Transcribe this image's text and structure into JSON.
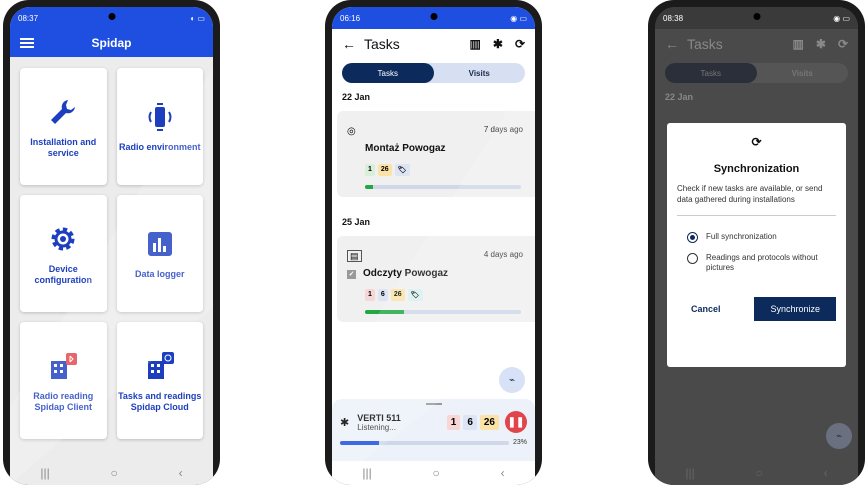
{
  "phone1": {
    "status_time": "08:37",
    "app_title": "Spidap",
    "tiles": [
      {
        "label": "Installation and service",
        "icon": "wrench-icon"
      },
      {
        "label": "Radio environment",
        "icon": "radio-device-icon"
      },
      {
        "label": "Device configuration",
        "icon": "gear-icon"
      },
      {
        "label": "Data logger",
        "icon": "bar-chart-icon"
      },
      {
        "label": "Radio reading Spidap Client",
        "icon": "building-bluetooth-icon"
      },
      {
        "label": "Tasks and readings Spidap Cloud",
        "icon": "building-cloud-icon"
      }
    ]
  },
  "phone2": {
    "status_time": "06:16",
    "title": "Tasks",
    "tabs": [
      "Tasks",
      "Visits"
    ],
    "groups": [
      {
        "date": "22 Jan",
        "ago": "7 days ago",
        "name": "Montaż Powogaz",
        "chips": [
          "1",
          "26"
        ],
        "progress": 0.05
      },
      {
        "date": "25 Jan",
        "ago": "4 days ago",
        "name": "Odczyty Powogaz",
        "chips": [
          "1",
          "6",
          "26"
        ],
        "progress": 0.25
      }
    ],
    "device": {
      "name": "VERTI 511",
      "status": "Listening...",
      "chips": [
        "1",
        "6",
        "26"
      ],
      "progress_label": "23%",
      "progress": 0.23
    }
  },
  "phone3": {
    "status_time": "08:38",
    "title": "Tasks",
    "tabs": [
      "Tasks",
      "Visits"
    ],
    "date": "22 Jan",
    "dialog": {
      "title": "Synchronization",
      "description": "Check if new tasks are available, or send data gathered during installations",
      "options": [
        "Full synchronization",
        "Readings and protocols without pictures"
      ],
      "cancel": "Cancel",
      "confirm": "Synchronize"
    }
  },
  "colors": {
    "primary": "#1f4fe0",
    "navy": "#0d2a5c",
    "green": "#23a743",
    "red": "#e0454b"
  }
}
